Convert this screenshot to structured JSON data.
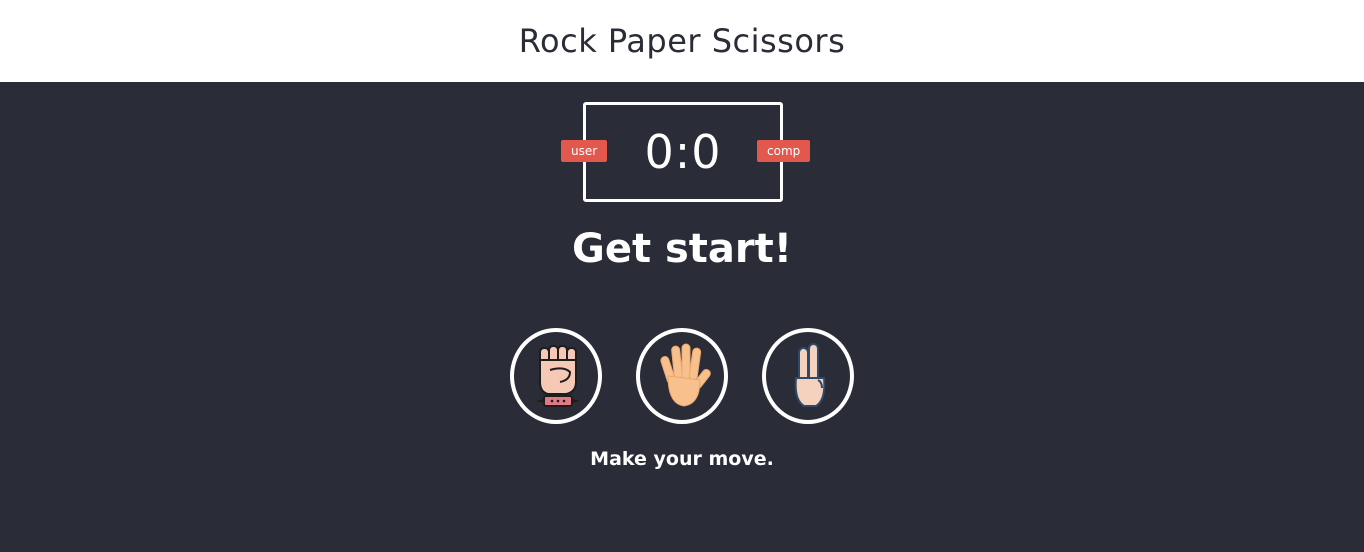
{
  "header": {
    "title": "Rock Paper Scissors"
  },
  "scoreboard": {
    "user_label": "user",
    "comp_label": "comp",
    "score": "0:0"
  },
  "result": {
    "message": "Get start!"
  },
  "choices": [
    {
      "name": "rock",
      "icon": "fist-icon"
    },
    {
      "name": "paper",
      "icon": "open-hand-icon"
    },
    {
      "name": "scissors",
      "icon": "two-fingers-icon"
    }
  ],
  "action": {
    "message": "Make your move."
  },
  "colors": {
    "background": "#2a2c37",
    "header_bg": "#ffffff",
    "badge": "#e2584d",
    "text": "#ffffff"
  }
}
